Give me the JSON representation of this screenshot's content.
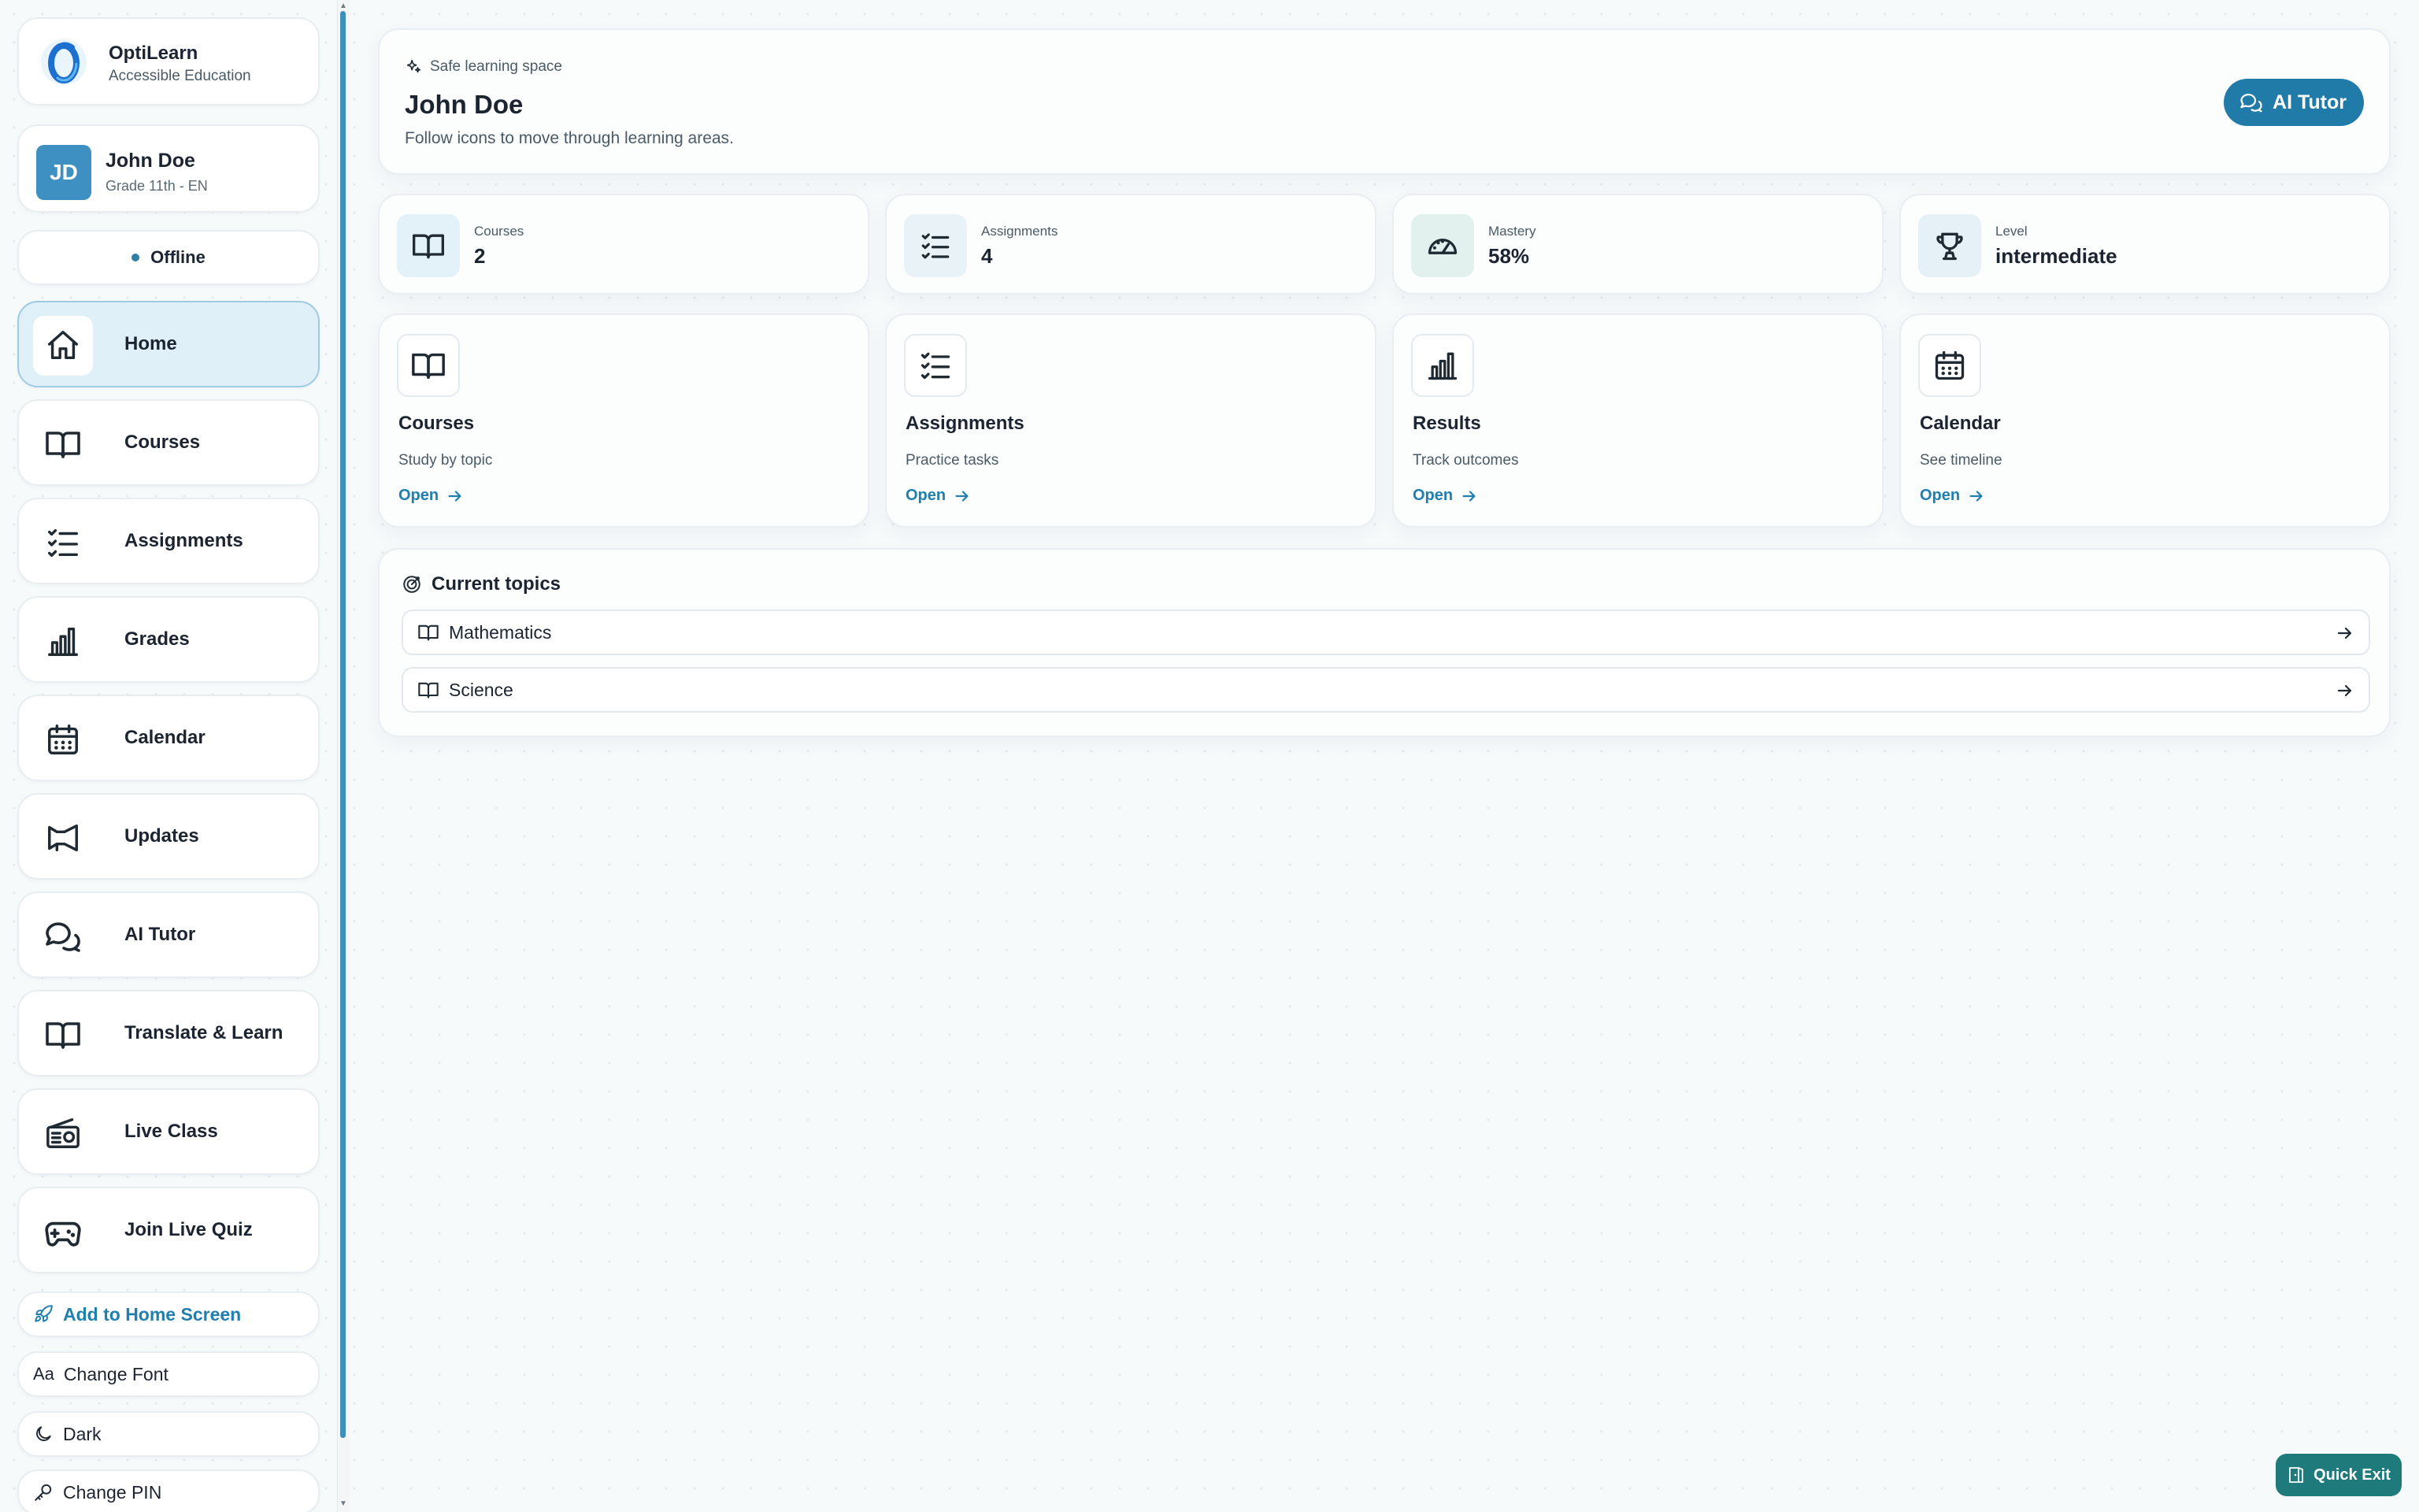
{
  "brand": {
    "name": "OptiLearn",
    "tagline": "Accessible Education"
  },
  "profile": {
    "initials": "JD",
    "name": "John Doe",
    "grade": "Grade 11th - EN"
  },
  "status": {
    "label": "Offline"
  },
  "nav": [
    {
      "label": "Home",
      "icon": "home-icon",
      "active": true
    },
    {
      "label": "Courses",
      "icon": "book-icon"
    },
    {
      "label": "Assignments",
      "icon": "checklist-icon"
    },
    {
      "label": "Grades",
      "icon": "bar-chart-icon"
    },
    {
      "label": "Calendar",
      "icon": "calendar-icon"
    },
    {
      "label": "Updates",
      "icon": "megaphone-icon"
    },
    {
      "label": "AI Tutor",
      "icon": "chat-bubbles-icon"
    },
    {
      "label": "Translate & Learn",
      "icon": "book-icon"
    },
    {
      "label": "Live Class",
      "icon": "radio-icon"
    },
    {
      "label": "Join Live Quiz",
      "icon": "gamepad-icon"
    }
  ],
  "actions": {
    "add_home": "Add to Home Screen",
    "change_font": "Change Font",
    "font_glyph": "Aa",
    "theme": "Dark",
    "change_pin": "Change PIN"
  },
  "header": {
    "eyebrow": "Safe learning space",
    "title": "John Doe",
    "description": "Follow icons to move through learning areas.",
    "tutor_button": "AI Tutor"
  },
  "stats": [
    {
      "label": "Courses",
      "value": "2",
      "icon": "book-icon",
      "bg": "#e3f1f9"
    },
    {
      "label": "Assignments",
      "value": "4",
      "icon": "checklist-icon",
      "bg": "#e9f3f7"
    },
    {
      "label": "Mastery",
      "value": "58%",
      "icon": "gauge-icon",
      "bg": "#e2f1ee"
    },
    {
      "label": "Level",
      "value": "intermediate",
      "icon": "trophy-icon",
      "bg": "#e6f0f7"
    }
  ],
  "tiles": [
    {
      "title": "Courses",
      "desc": "Study by topic",
      "open": "Open",
      "icon": "book-icon"
    },
    {
      "title": "Assignments",
      "desc": "Practice tasks",
      "open": "Open",
      "icon": "checklist-icon"
    },
    {
      "title": "Results",
      "desc": "Track outcomes",
      "open": "Open",
      "icon": "bar-chart-icon"
    },
    {
      "title": "Calendar",
      "desc": "See timeline",
      "open": "Open",
      "icon": "calendar-icon"
    }
  ],
  "topics": {
    "title": "Current topics",
    "items": [
      {
        "name": "Mathematics"
      },
      {
        "name": "Science"
      }
    ]
  },
  "quick_exit": "Quick Exit",
  "colors": {
    "accent": "#217ba8",
    "active_bg": "#dff0f8",
    "quick_exit": "#1f7a7c"
  }
}
